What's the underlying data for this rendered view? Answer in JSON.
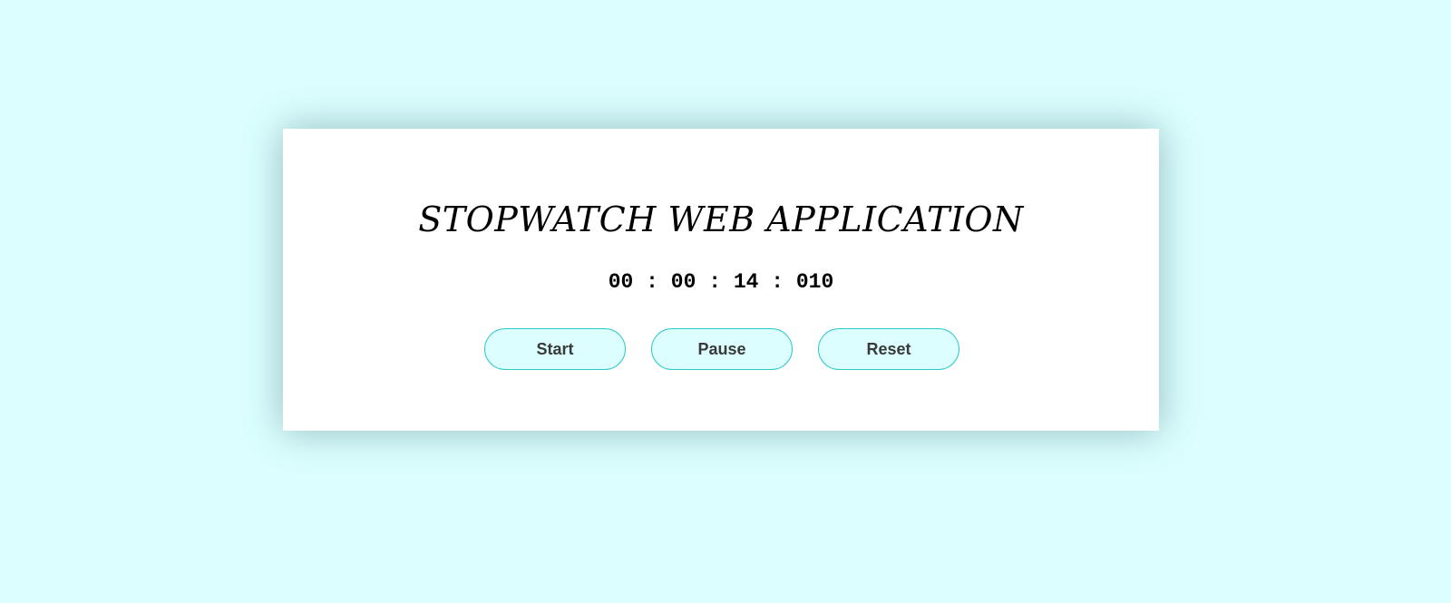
{
  "app": {
    "title": "STOPWATCH WEB APPLICATION"
  },
  "timer": {
    "hours": "00",
    "minutes": "00",
    "seconds": "14",
    "milliseconds": "010",
    "separator": ":"
  },
  "controls": {
    "start_label": "Start",
    "pause_label": "Pause",
    "reset_label": "Reset"
  },
  "colors": {
    "background": "#dcfefe",
    "card": "#ffffff",
    "button_border": "#2ec8c8",
    "button_fill": "#dcfefe"
  }
}
